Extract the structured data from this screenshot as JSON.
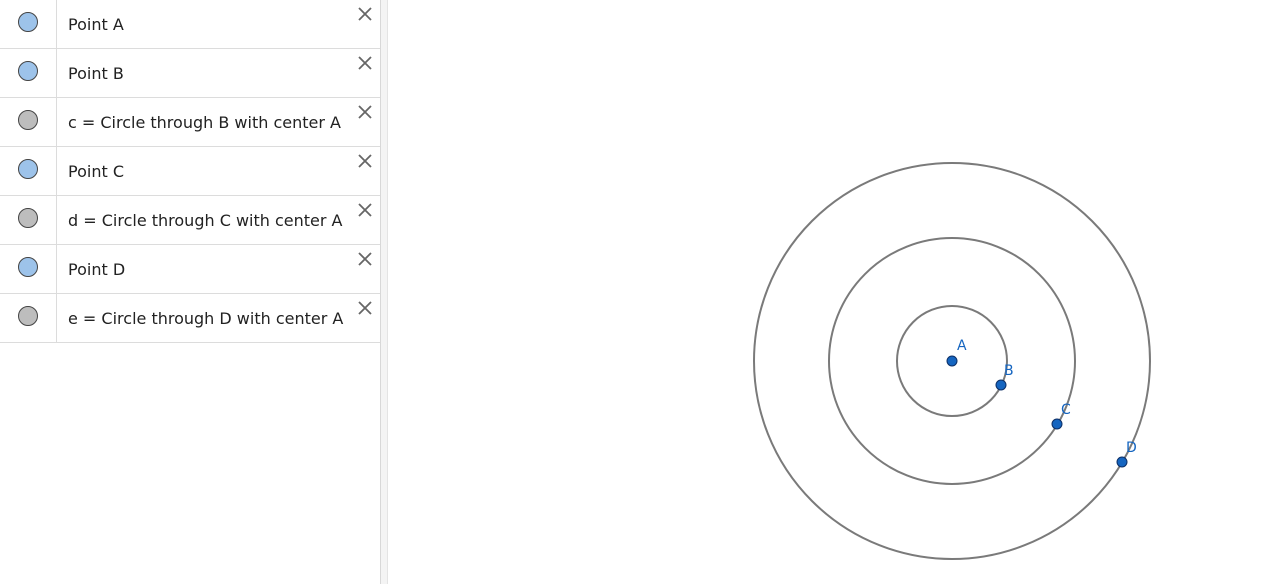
{
  "colors": {
    "point_fill": "#1565c0",
    "point_stroke": "#0d2f66",
    "label": "#1565c0",
    "circle_stroke": "#7a7a7a",
    "marble_point": "#9dc3ea",
    "marble_circle": "#bdbdbd",
    "delete_icon": "#666666"
  },
  "algebra": {
    "items": [
      {
        "text": "Point A",
        "kind": "point"
      },
      {
        "text": "Point B",
        "kind": "point"
      },
      {
        "text": "c = Circle through B with center A",
        "kind": "circle"
      },
      {
        "text": "Point C",
        "kind": "point"
      },
      {
        "text": "d = Circle through C with center A",
        "kind": "circle"
      },
      {
        "text": "Point D",
        "kind": "point"
      },
      {
        "text": "e = Circle through D with center A",
        "kind": "circle"
      }
    ]
  },
  "graphics": {
    "points": [
      {
        "label": "A"
      },
      {
        "label": "B"
      },
      {
        "label": "C"
      },
      {
        "label": "D"
      }
    ]
  }
}
